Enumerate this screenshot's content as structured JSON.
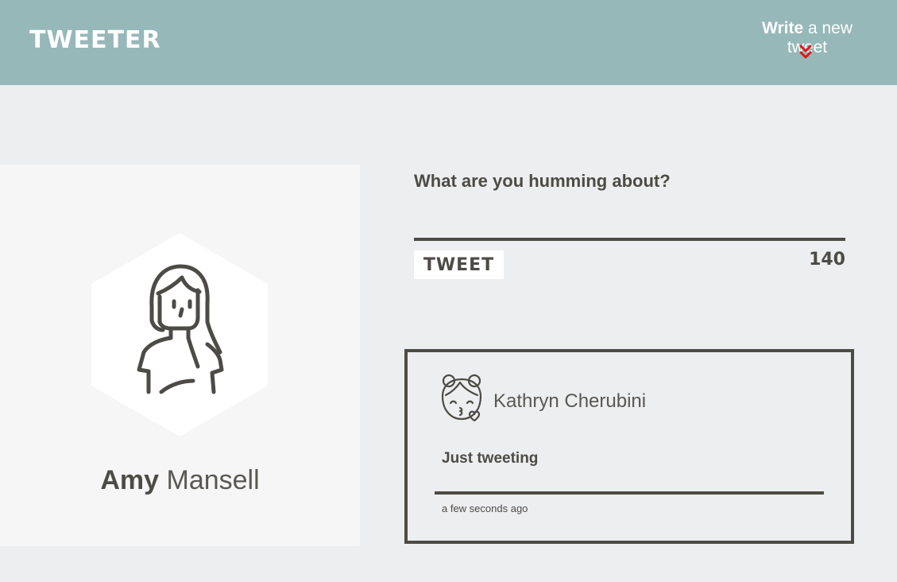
{
  "nav": {
    "brand": "TWEETER",
    "compose_strong": "Write",
    "compose_rest": " a new tweet",
    "chevron_icon": "double-chevron-down-icon",
    "chevron_color": "#e01818",
    "background": "#97b8b9"
  },
  "profile": {
    "first_name": "Amy",
    "last_name": " Mansell",
    "avatar_icon": "woman-avatar-icon"
  },
  "composer": {
    "prompt": "What are you humming about?",
    "button_label": "TWEET",
    "counter": "140"
  },
  "tweets": [
    {
      "author": "Kathryn Cherubini",
      "avatar_icon": "girl-kiss-avatar-icon",
      "text": "Just tweeting",
      "time": "a few seconds ago"
    }
  ],
  "colors": {
    "page_background": "#edeef0",
    "text": "#4d4b45",
    "card_background": "#f6f6f6"
  }
}
